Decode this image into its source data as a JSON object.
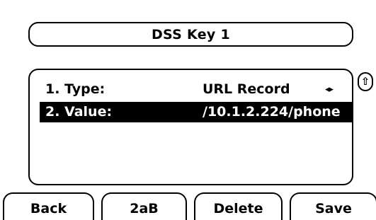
{
  "header": {
    "title": "DSS Key 1"
  },
  "list": {
    "items": [
      {
        "label": "1. Type:",
        "value": "URL Record",
        "selected": false,
        "arrows": "◂▸"
      },
      {
        "label": "2. Value:",
        "value": "/10.1.2.224/phone",
        "selected": true
      }
    ]
  },
  "scroll": {
    "icon": "scroll-up-icon",
    "glyph": "⇧"
  },
  "softkeys": [
    {
      "label": "Back"
    },
    {
      "label": "2aB"
    },
    {
      "label": "Delete"
    },
    {
      "label": "Save"
    }
  ],
  "colors": {
    "background": "#ffffff",
    "foreground": "#000000",
    "selected_background": "#000000",
    "selected_text": "#ffffff"
  }
}
